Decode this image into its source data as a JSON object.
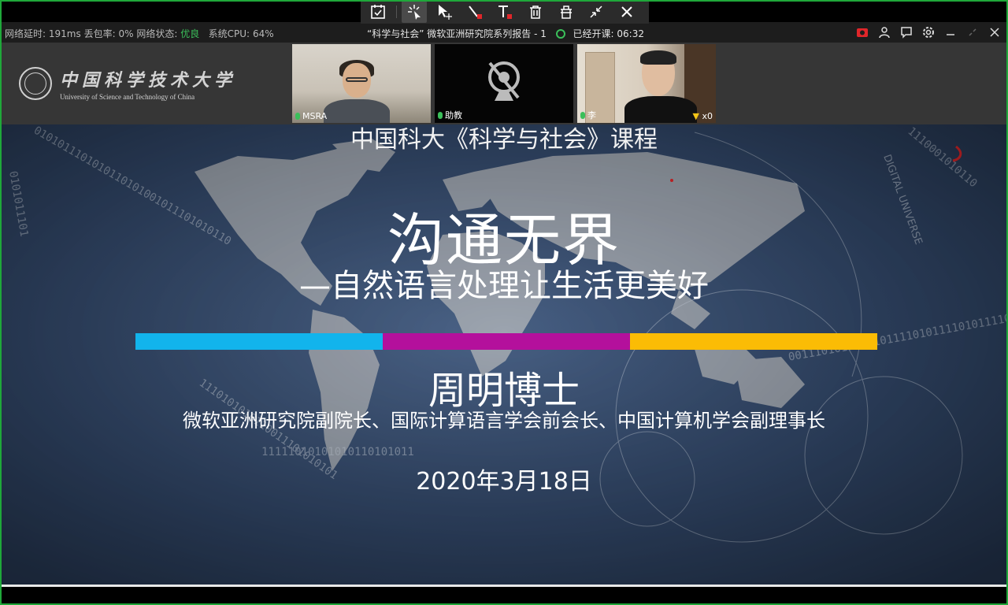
{
  "toolbar": {
    "tools": [
      "select-all",
      "laser-pointer",
      "move",
      "pen",
      "text",
      "delete",
      "clear",
      "collapse",
      "close"
    ]
  },
  "statusbar": {
    "latency_label": "网络延时:",
    "latency_value": "191ms",
    "loss_label": "丢包率:",
    "loss_value": "0%",
    "network_label": "网络状态:",
    "network_value": "优良",
    "cpu_label": "系统CPU:",
    "cpu_value": "64%",
    "window_title": "“科学与社会” 微软亚洲研究院系列报告 - 1",
    "elapsed_label": "已经开课:",
    "elapsed_value": "06:32"
  },
  "header": {
    "logo_cn": "中国科学技术大学",
    "logo_en": "University of Science and Technology of China",
    "tiles": [
      {
        "label": "MSRA"
      },
      {
        "label": "助教"
      },
      {
        "label": "李",
        "trophy": "x0"
      }
    ]
  },
  "slide": {
    "course": "中国科大《科学与社会》课程",
    "title": "沟通无界",
    "subtitle": "—自然语言处理让生活更美好",
    "speaker": "周明博士",
    "position": "微软亚洲研究院副院长、国际计算语言学会前会长、中国计算机学会副理事长",
    "date": "2020年3月18日",
    "bar_colors": [
      "#12b4ec",
      "#b4109c",
      "#fbbc05"
    ],
    "ring_text": "DIGITAL UNIVERSE"
  },
  "colors": {
    "status_good": "#3bbf5a",
    "frame": "#1fa83a"
  }
}
